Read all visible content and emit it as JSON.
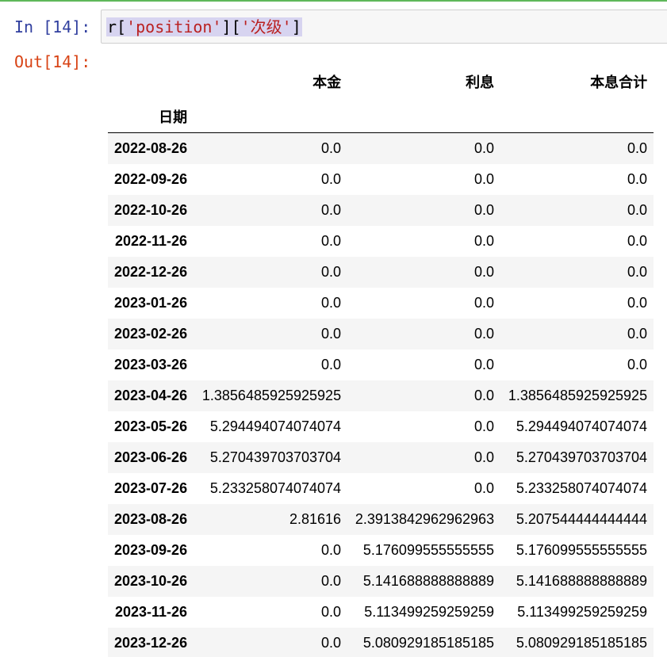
{
  "cell": {
    "in_prompt": "In [14]:",
    "out_prompt": "Out[14]:",
    "code": {
      "var": "r",
      "open1": "[",
      "key1": "'position'",
      "close1": "]",
      "open2": "[",
      "key2": "'次级'",
      "close2": "]"
    }
  },
  "table": {
    "columns": [
      "本金",
      "利息",
      "本息合计"
    ],
    "index_name": "日期",
    "rows": [
      {
        "date": "2022-08-26",
        "principal": "0.0",
        "interest": "0.0",
        "total": "0.0"
      },
      {
        "date": "2022-09-26",
        "principal": "0.0",
        "interest": "0.0",
        "total": "0.0"
      },
      {
        "date": "2022-10-26",
        "principal": "0.0",
        "interest": "0.0",
        "total": "0.0"
      },
      {
        "date": "2022-11-26",
        "principal": "0.0",
        "interest": "0.0",
        "total": "0.0"
      },
      {
        "date": "2022-12-26",
        "principal": "0.0",
        "interest": "0.0",
        "total": "0.0"
      },
      {
        "date": "2023-01-26",
        "principal": "0.0",
        "interest": "0.0",
        "total": "0.0"
      },
      {
        "date": "2023-02-26",
        "principal": "0.0",
        "interest": "0.0",
        "total": "0.0"
      },
      {
        "date": "2023-03-26",
        "principal": "0.0",
        "interest": "0.0",
        "total": "0.0"
      },
      {
        "date": "2023-04-26",
        "principal": "1.3856485925925925",
        "interest": "0.0",
        "total": "1.3856485925925925"
      },
      {
        "date": "2023-05-26",
        "principal": "5.294494074074074",
        "interest": "0.0",
        "total": "5.294494074074074"
      },
      {
        "date": "2023-06-26",
        "principal": "5.270439703703704",
        "interest": "0.0",
        "total": "5.270439703703704"
      },
      {
        "date": "2023-07-26",
        "principal": "5.233258074074074",
        "interest": "0.0",
        "total": "5.233258074074074"
      },
      {
        "date": "2023-08-26",
        "principal": "2.81616",
        "interest": "2.3913842962962963",
        "total": "5.207544444444444"
      },
      {
        "date": "2023-09-26",
        "principal": "0.0",
        "interest": "5.176099555555555",
        "total": "5.176099555555555"
      },
      {
        "date": "2023-10-26",
        "principal": "0.0",
        "interest": "5.141688888888889",
        "total": "5.141688888888889"
      },
      {
        "date": "2023-11-26",
        "principal": "0.0",
        "interest": "5.113499259259259",
        "total": "5.113499259259259"
      },
      {
        "date": "2023-12-26",
        "principal": "0.0",
        "interest": "5.080929185185185",
        "total": "5.080929185185185"
      }
    ]
  },
  "colors": {
    "in_prompt": "#303f9f",
    "out_prompt": "#d84315",
    "string_literal": "#ba2121",
    "selection": "#d7d4f0",
    "cell_border_active": "#5fb85a"
  }
}
